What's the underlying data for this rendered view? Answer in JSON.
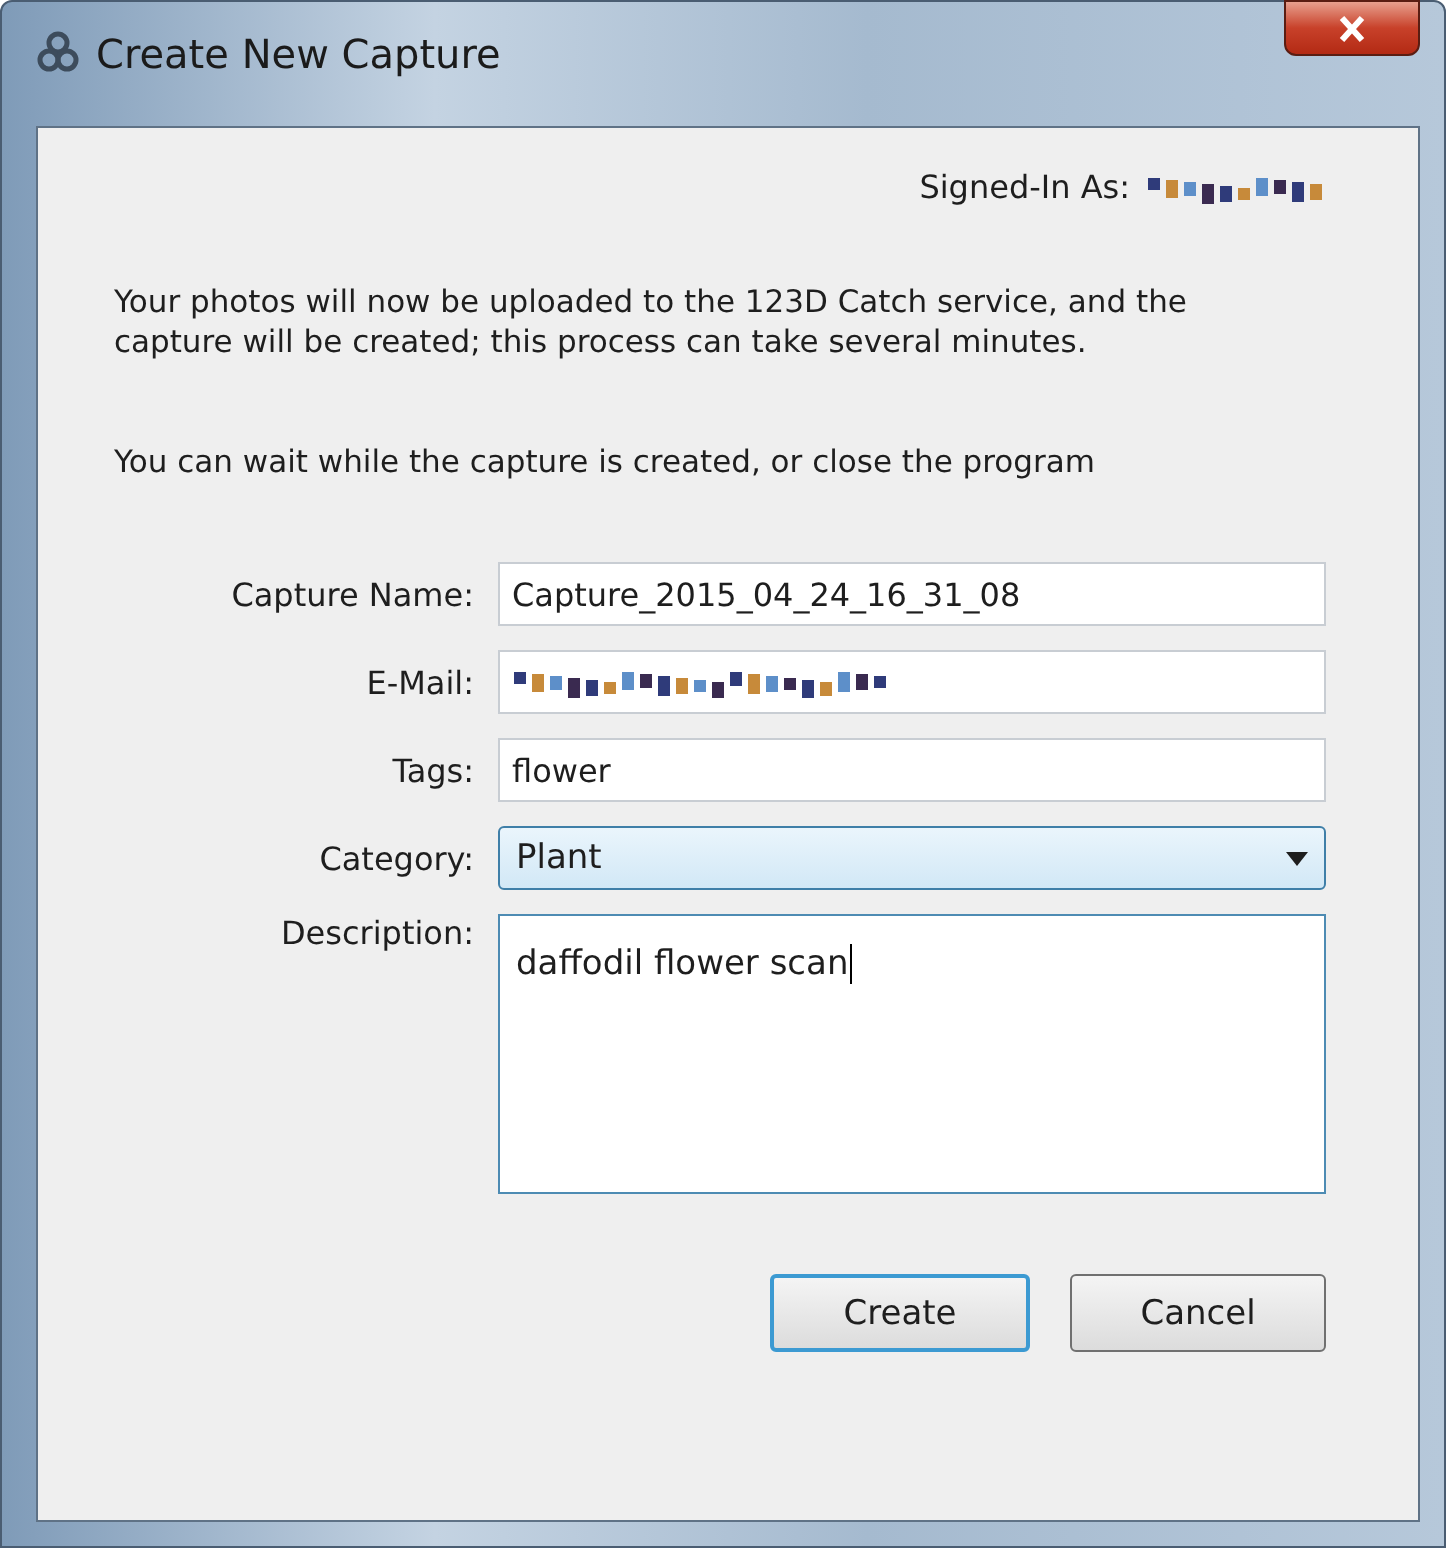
{
  "window": {
    "title": "Create New Capture"
  },
  "signed_in": {
    "label": "Signed-In As:",
    "obscured": true
  },
  "paragraphs": [
    "Your photos will now be uploaded to the 123D Catch service, and the capture will be created; this process can take several minutes.",
    "You can wait while the capture is created, or close the program"
  ],
  "fields": [
    {
      "kind": "text",
      "label": "Capture Name:",
      "value": "Capture_2015_04_24_16_31_08",
      "obscured": false
    },
    {
      "kind": "text",
      "label": "E-Mail:",
      "obscured": true
    },
    {
      "kind": "text",
      "label": "Tags:",
      "value": "flower",
      "obscured": false
    },
    {
      "kind": "select",
      "label": "Category:",
      "value": "Plant",
      "obscured": false
    },
    {
      "kind": "textarea",
      "label": "Description:",
      "value": "daffodil flower scan",
      "obscured": false
    }
  ],
  "buttons": [
    {
      "label": "Create",
      "default": true
    },
    {
      "label": "Cancel",
      "default": false
    }
  ]
}
